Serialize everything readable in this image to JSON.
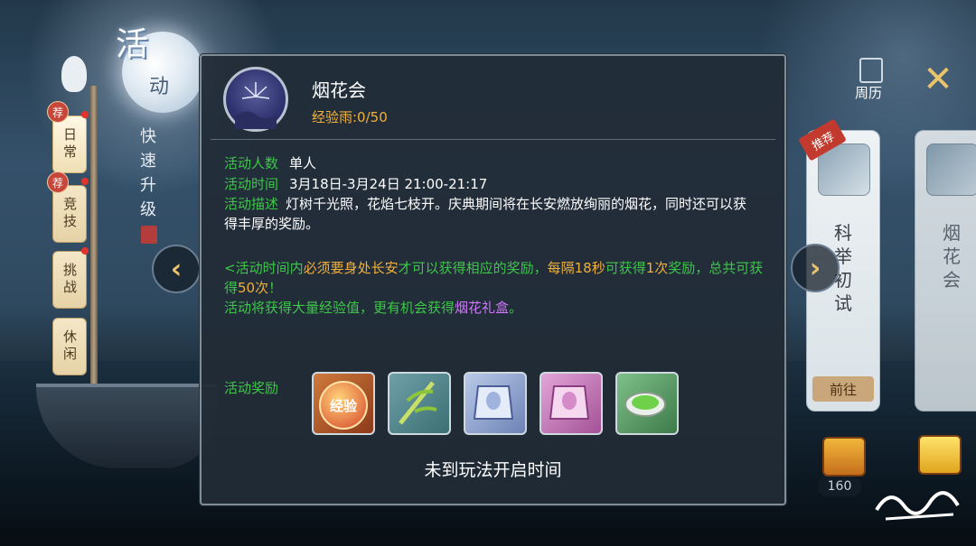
{
  "side": {
    "title_big": "活",
    "title_small": "动",
    "quick_level": "快速升级",
    "tabs": [
      {
        "label": "日常",
        "badge": "荐",
        "active": true
      },
      {
        "label": "竞技",
        "badge": "荐",
        "active": false
      },
      {
        "label": "挑战",
        "badge": "",
        "active": false
      },
      {
        "label": "休闲",
        "badge": "",
        "active": false
      }
    ]
  },
  "dialog": {
    "title": "烟花会",
    "subtitle": "经验雨:0/50",
    "rows": [
      {
        "label": "活动人数",
        "value": "单人"
      },
      {
        "label": "活动时间",
        "value": "3月18日-3月24日 21:00-21:17"
      }
    ],
    "desc_label": "活动描述",
    "desc_text": "灯树千光照，花焰七枝开。庆典期间将在长安燃放绚丽的烟花，同时还可以获得丰厚的奖励。",
    "notice": {
      "p1": "<活动时间内",
      "p2": "必须要身处长安",
      "p3": "才可以获得相应的奖励，",
      "p4": "每隔18秒",
      "p5": "可获得",
      "p6": "1次",
      "p7": "奖励，总共可获得",
      "p8": "50次",
      "p9": "！",
      "p10": "活动将获得大量经验值，更有机会获得",
      "p11": "烟花礼盒",
      "p12": "。"
    },
    "reward_label": "活动奖励",
    "rewards": [
      {
        "icon": "exp-orb-icon",
        "text": "经验"
      },
      {
        "icon": "bamboo-icon",
        "text": ""
      },
      {
        "icon": "blue-pouch-icon",
        "text": ""
      },
      {
        "icon": "pink-pouch-icon",
        "text": ""
      },
      {
        "icon": "jade-dish-icon",
        "text": ""
      }
    ],
    "status": "未到玩法开启时间"
  },
  "right": {
    "calendar_label": "周历",
    "card1": {
      "badge": "推荐",
      "title": "科举初试",
      "button": "前往"
    },
    "card2": {
      "title": "烟花会"
    },
    "count": "160"
  },
  "colors": {
    "green": "#3ec64a",
    "orange": "#f0b03a",
    "purple": "#d276ff",
    "gold": "#e9c46a"
  }
}
